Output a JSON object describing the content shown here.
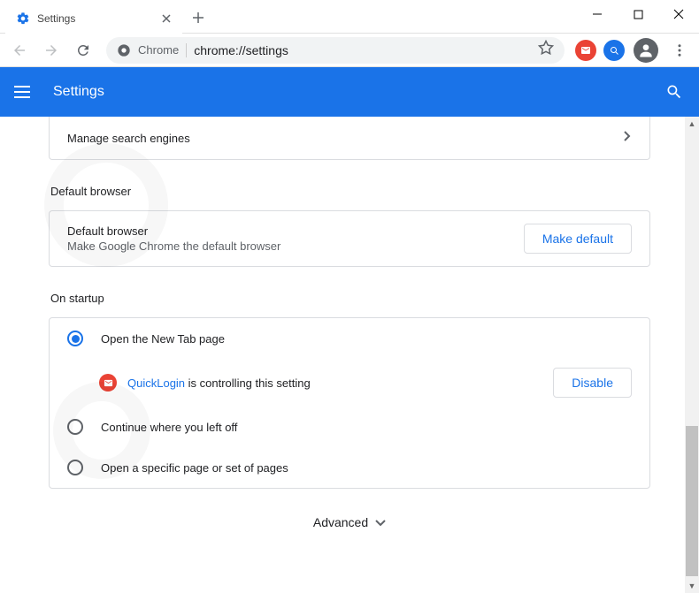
{
  "window": {
    "tab_title": "Settings"
  },
  "omnibox": {
    "scheme_label": "Chrome",
    "url": "chrome://settings"
  },
  "header": {
    "title": "Settings"
  },
  "manage_engines": {
    "label": "Manage search engines"
  },
  "default_browser": {
    "section_title": "Default browser",
    "row_title": "Default browser",
    "row_subtitle": "Make Google Chrome the default browser",
    "button": "Make default"
  },
  "on_startup": {
    "section_title": "On startup",
    "options": [
      {
        "label": "Open the New Tab page",
        "selected": true
      },
      {
        "label": "Continue where you left off",
        "selected": false
      },
      {
        "label": "Open a specific page or set of pages",
        "selected": false
      }
    ],
    "controlled": {
      "extension_name": "QuickLogin",
      "suffix_text": " is controlling this setting",
      "disable_button": "Disable"
    }
  },
  "advanced": {
    "label": "Advanced"
  },
  "colors": {
    "primary": "#1a73e8",
    "danger": "#ea4335"
  }
}
